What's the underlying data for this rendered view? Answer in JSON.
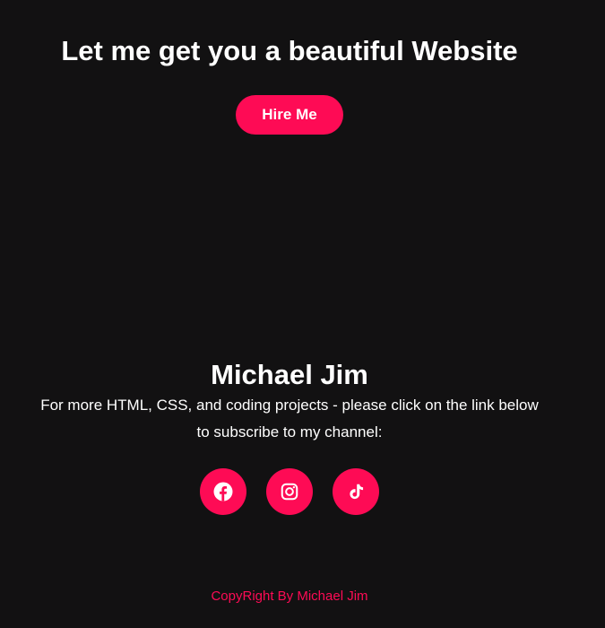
{
  "hero": {
    "title": "Let me get you a beautiful Website",
    "hire_button_label": "Hire Me"
  },
  "profile": {
    "name": "Michael Jim",
    "description": "For more HTML, CSS, and coding projects - please click on the link below to subscribe to my channel:"
  },
  "socials": [
    {
      "name": "facebook",
      "icon": "facebook-icon"
    },
    {
      "name": "instagram",
      "icon": "instagram-icon"
    },
    {
      "name": "tiktok",
      "icon": "tiktok-icon"
    }
  ],
  "footer": {
    "copyright": "CopyRight By Michael Jim"
  },
  "colors": {
    "background": "#121112",
    "accent": "#fe0b55",
    "text": "#ffffff"
  }
}
